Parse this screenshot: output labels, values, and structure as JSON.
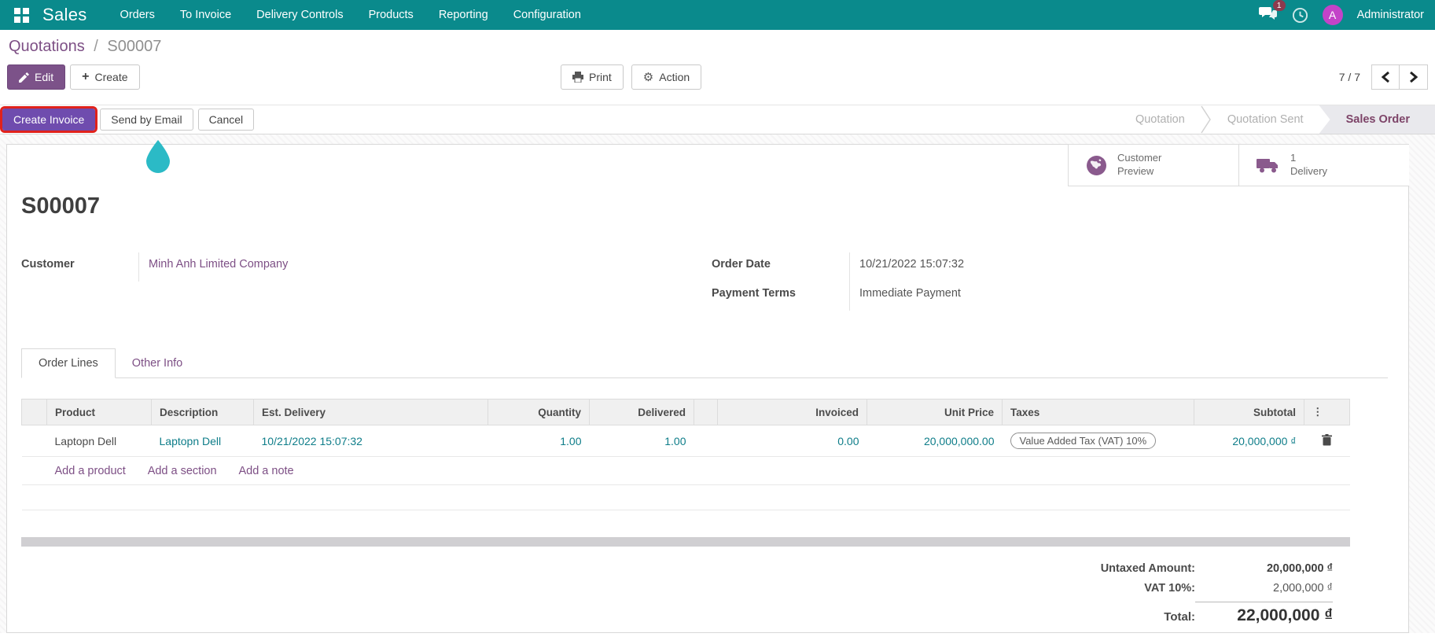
{
  "nav": {
    "app_name": "Sales",
    "menus": [
      "Orders",
      "To Invoice",
      "Delivery Controls",
      "Products",
      "Reporting",
      "Configuration"
    ],
    "messages_badge": "1",
    "user": {
      "initial": "A",
      "name": "Administrator"
    }
  },
  "breadcrumb": {
    "parent": "Quotations",
    "separator": "/",
    "current": "S00007"
  },
  "control_panel": {
    "edit": "Edit",
    "create": "Create",
    "print": "Print",
    "action": "Action",
    "pager": "7 / 7"
  },
  "statusbar": {
    "create_invoice": "Create Invoice",
    "send_by_email": "Send by Email",
    "cancel": "Cancel",
    "stages": [
      {
        "label": "Quotation",
        "active": false
      },
      {
        "label": "Quotation Sent",
        "active": false
      },
      {
        "label": "Sales Order",
        "active": true
      }
    ]
  },
  "smart_buttons": [
    {
      "icon": "globe-icon",
      "line1": "Customer",
      "line2": "Preview"
    },
    {
      "icon": "truck-icon",
      "line1": "1",
      "line2": "Delivery"
    }
  ],
  "form": {
    "title": "S00007",
    "customer_label": "Customer",
    "customer_value": "Minh Anh Limited Company",
    "order_date_label": "Order Date",
    "order_date_value": "10/21/2022 15:07:32",
    "payment_terms_label": "Payment Terms",
    "payment_terms_value": "Immediate Payment"
  },
  "tabs": [
    {
      "label": "Order Lines",
      "active": true
    },
    {
      "label": "Other Info",
      "active": false
    }
  ],
  "order_lines": {
    "columns": [
      "Product",
      "Description",
      "Est. Delivery",
      "Quantity",
      "Delivered",
      "Invoiced",
      "Unit Price",
      "Taxes",
      "Subtotal"
    ],
    "rows": [
      {
        "product": "Laptopn Dell",
        "description": "Laptopn Dell",
        "est_delivery": "10/21/2022 15:07:32",
        "quantity": "1.00",
        "delivered": "1.00",
        "invoiced": "0.00",
        "unit_price": "20,000,000.00",
        "taxes": "Value Added Tax (VAT) 10%",
        "subtotal": "20,000,000 ₫"
      }
    ],
    "add_links": [
      "Add a product",
      "Add a section",
      "Add a note"
    ]
  },
  "totals": {
    "untaxed_label": "Untaxed Amount:",
    "untaxed_value": "20,000,000 ₫",
    "vat_label": "VAT 10%:",
    "vat_value": "2,000,000 ₫",
    "total_label": "Total:",
    "total_value": "22,000,000 ₫"
  },
  "colors": {
    "navbar_teal": "#0a8a8c",
    "link_purple": "#7d4f85",
    "primary_violet": "#6f4cae",
    "highlight_red": "#e0221c",
    "value_teal": "#0e7d89",
    "droplet_teal": "#2bbac6",
    "avatar_magenta": "#c343c8",
    "badge_maroon": "#8d3a4e"
  }
}
